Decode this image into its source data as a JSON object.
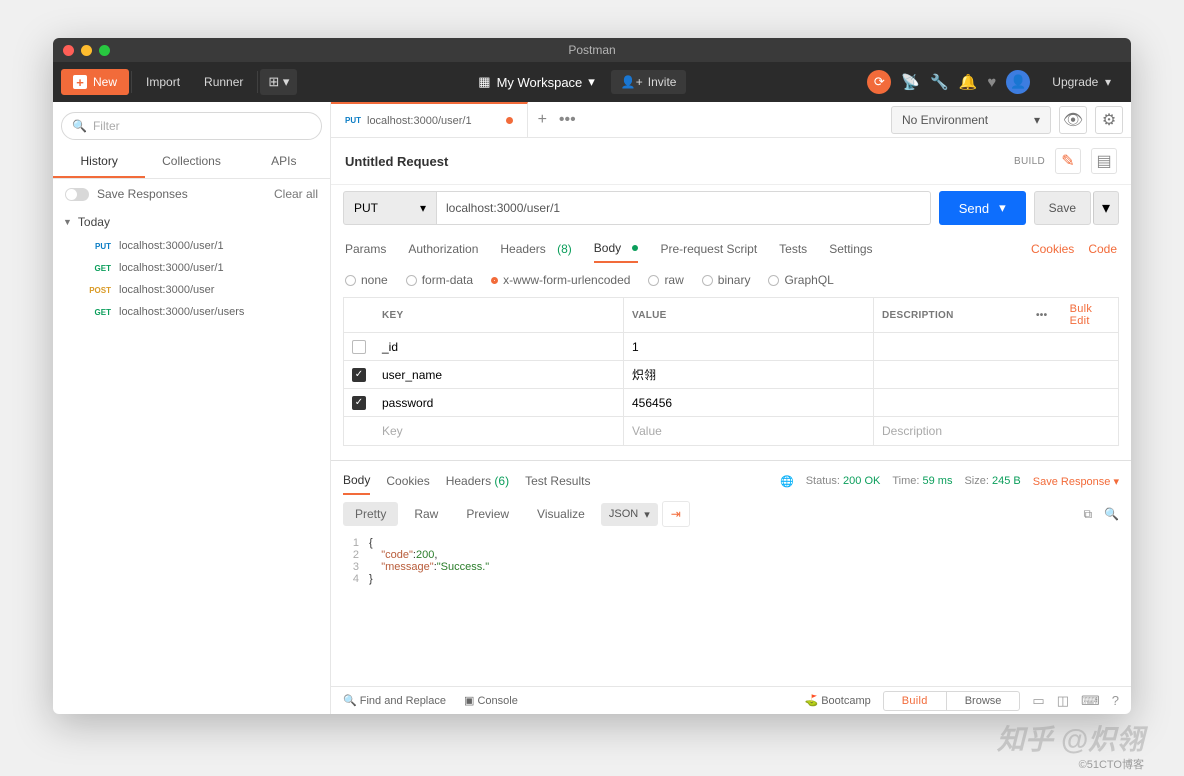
{
  "title": "Postman",
  "toolbar": {
    "new": "New",
    "import": "Import",
    "runner": "Runner",
    "workspace": "My Workspace",
    "invite": "Invite",
    "upgrade": "Upgrade"
  },
  "sidebar": {
    "filter_placeholder": "Filter",
    "tabs": [
      "History",
      "Collections",
      "APIs"
    ],
    "save_responses": "Save Responses",
    "clear_all": "Clear all",
    "group": "Today",
    "items": [
      {
        "method": "PUT",
        "url": "localhost:3000/user/1"
      },
      {
        "method": "GET",
        "url": "localhost:3000/user/1"
      },
      {
        "method": "POST",
        "url": "localhost:3000/user"
      },
      {
        "method": "GET",
        "url": "localhost:3000/user/users"
      }
    ]
  },
  "tab": {
    "method": "PUT",
    "url": "localhost:3000/user/1"
  },
  "env": {
    "label": "No Environment"
  },
  "request": {
    "title": "Untitled Request",
    "build": "BUILD",
    "method": "PUT",
    "url": "localhost:3000/user/1",
    "send": "Send",
    "save": "Save",
    "subtabs": {
      "params": "Params",
      "auth": "Authorization",
      "headers": "Headers",
      "headers_count": "(8)",
      "body": "Body",
      "prereq": "Pre-request Script",
      "tests": "Tests",
      "settings": "Settings",
      "cookies": "Cookies",
      "code": "Code"
    },
    "body_types": [
      "none",
      "form-data",
      "x-www-form-urlencoded",
      "raw",
      "binary",
      "GraphQL"
    ],
    "table_headers": {
      "key": "KEY",
      "value": "VALUE",
      "desc": "DESCRIPTION",
      "bulk": "Bulk Edit"
    },
    "rows": [
      {
        "enabled": false,
        "key": "_id",
        "value": "1"
      },
      {
        "enabled": true,
        "key": "user_name",
        "value": "炽翎"
      },
      {
        "enabled": true,
        "key": "password",
        "value": "456456"
      }
    ],
    "placeholder": {
      "key": "Key",
      "value": "Value",
      "desc": "Description"
    }
  },
  "response": {
    "tabs": {
      "body": "Body",
      "cookies": "Cookies",
      "headers": "Headers",
      "headers_count": "(6)",
      "tests": "Test Results"
    },
    "status_lbl": "Status:",
    "status": "200 OK",
    "time_lbl": "Time:",
    "time": "59 ms",
    "size_lbl": "Size:",
    "size": "245 B",
    "save_response": "Save Response",
    "fmt": {
      "pretty": "Pretty",
      "raw": "Raw",
      "preview": "Preview",
      "visualize": "Visualize",
      "json": "JSON"
    },
    "json": {
      "code_key": "\"code\"",
      "code_val": "200",
      "msg_key": "\"message\"",
      "msg_val": "\"Success.\""
    }
  },
  "footer": {
    "find": "Find and Replace",
    "console": "Console",
    "bootcamp": "Bootcamp",
    "build": "Build",
    "browse": "Browse"
  },
  "watermark": "知乎 @炽翎",
  "attrib": "©51CTO博客"
}
